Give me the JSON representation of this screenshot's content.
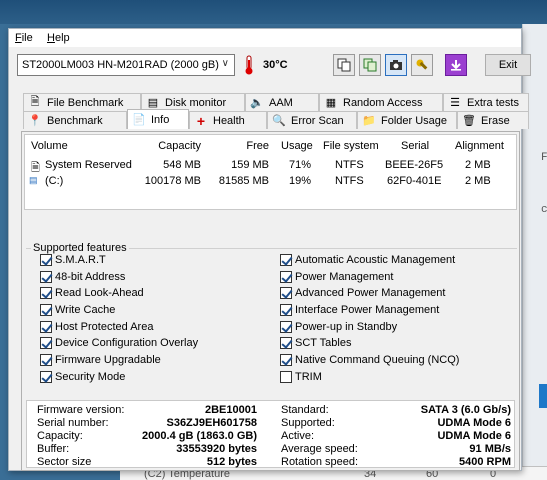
{
  "menu": {
    "file": "File",
    "help": "Help"
  },
  "toolbar": {
    "drive": "ST2000LM003 HN-M201RAD (2000 gB)",
    "temperature": "30°C",
    "exit_label": "Exit",
    "icons": [
      "copy-icon",
      "copy-green-icon",
      "camera-icon",
      "wrench-icon",
      "download-icon"
    ]
  },
  "tabs_row1": [
    "File Benchmark",
    "Disk monitor",
    "AAM",
    "Random Access",
    "Extra tests"
  ],
  "tabs_row2": [
    "Benchmark",
    "Info",
    "Health",
    "Error Scan",
    "Folder Usage",
    "Erase"
  ],
  "selected_tab": "Info",
  "volumes": {
    "headers": [
      "Volume",
      "Capacity",
      "Free",
      "Usage",
      "File system",
      "Serial",
      "Alignment"
    ],
    "rows": [
      [
        "System Reserved",
        "548 MB",
        "159 MB",
        "71%",
        "NTFS",
        "BEEE-26F5",
        "2 MB"
      ],
      [
        "(C:)",
        "100178 MB",
        "81585 MB",
        "19%",
        "NTFS",
        "62F0-401E",
        "2 MB"
      ]
    ]
  },
  "features": {
    "legend": "Supported features",
    "left": [
      {
        "label": "S.M.A.R.T",
        "checked": true
      },
      {
        "label": "48-bit Address",
        "checked": true
      },
      {
        "label": "Read Look-Ahead",
        "checked": true
      },
      {
        "label": "Write Cache",
        "checked": true
      },
      {
        "label": "Host Protected Area",
        "checked": true
      },
      {
        "label": "Device Configuration Overlay",
        "checked": true
      },
      {
        "label": "Firmware Upgradable",
        "checked": true
      },
      {
        "label": "Security Mode",
        "checked": true
      }
    ],
    "right": [
      {
        "label": "Automatic Acoustic Management",
        "checked": true
      },
      {
        "label": "Power Management",
        "checked": true
      },
      {
        "label": "Advanced Power Management",
        "checked": true
      },
      {
        "label": "Interface Power Management",
        "checked": true
      },
      {
        "label": "Power-up in Standby",
        "checked": true
      },
      {
        "label": "SCT Tables",
        "checked": true
      },
      {
        "label": "Native Command Queuing (NCQ)",
        "checked": true
      },
      {
        "label": "TRIM",
        "checked": false
      }
    ]
  },
  "details": {
    "left": [
      {
        "label": "Firmware version:",
        "value": "2BE10001"
      },
      {
        "label": "Serial number:",
        "value": "S36ZJ9EH601758"
      },
      {
        "label": "Capacity:",
        "value": "2000.4 gB (1863.0 GB)"
      },
      {
        "label": "Buffer:",
        "value": "33553920 bytes"
      },
      {
        "label": "Sector size",
        "value": "512 bytes"
      }
    ],
    "right": [
      {
        "label": "Standard:",
        "value": "SATA 3 (6.0 Gb/s)"
      },
      {
        "label": "Supported:",
        "value": "UDMA Mode 6"
      },
      {
        "label": "Active:",
        "value": "UDMA Mode 6"
      },
      {
        "label": "Average speed:",
        "value": "91 MB/s"
      },
      {
        "label": "Rotation speed:",
        "value": "5400 RPM"
      }
    ]
  },
  "background": {
    "bottom_row": [
      "(C2) Temperature",
      "34",
      "60",
      "0"
    ]
  }
}
